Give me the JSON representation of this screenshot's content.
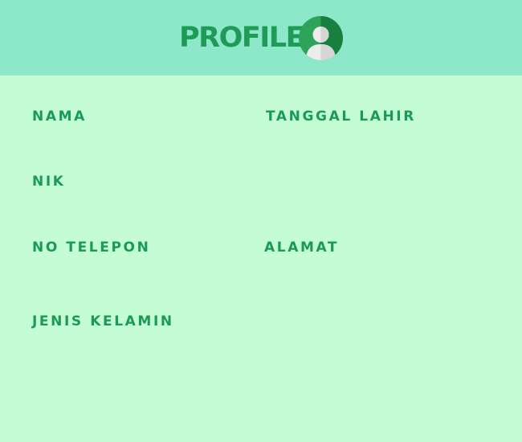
{
  "header": {
    "title": "PROFILE",
    "icon": "user-avatar-icon"
  },
  "fields": {
    "nama": "NAMA",
    "tanggal_lahir": "TANGGAL LAHIR",
    "nik": "NIK",
    "no_telepon": "NO TELEPON",
    "alamat": "ALAMAT",
    "jenis_kelamin": "JENIS KELAMIN"
  },
  "colors": {
    "background": "#c4fdd4",
    "header_background": "#8ce8c8",
    "accent": "#1a9a55",
    "avatar_dark": "#17803f",
    "avatar_light": "#2ea35a"
  }
}
